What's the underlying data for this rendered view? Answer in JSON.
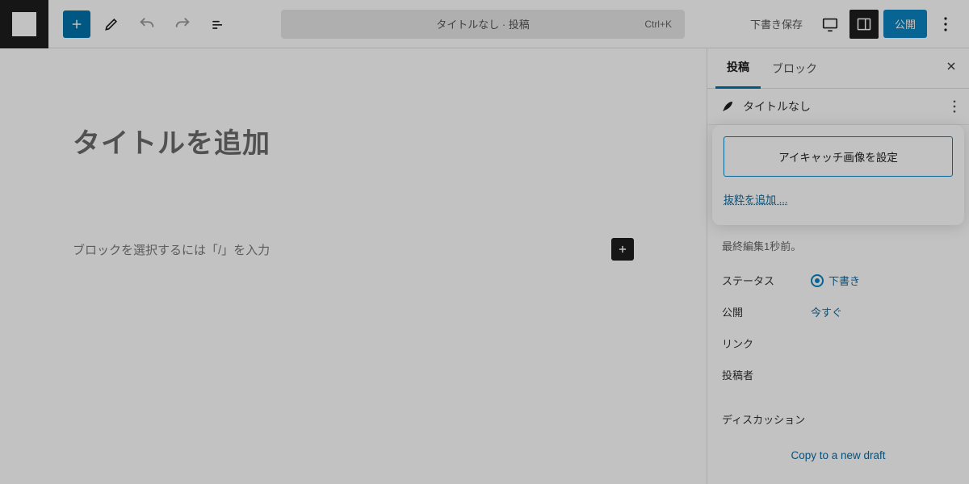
{
  "topbar": {
    "doc_title": "タイトルなし · 投稿",
    "shortcut": "Ctrl+K",
    "save_draft": "下書き保存",
    "publish": "公開"
  },
  "editor": {
    "title_placeholder": "タイトルを追加",
    "block_placeholder": "ブロックを選択するには「/」を入力"
  },
  "sidebar": {
    "tabs": {
      "post": "投稿",
      "block": "ブロック"
    },
    "summary_title": "タイトルなし",
    "featured_image_button": "アイキャッチ画像を設定",
    "excerpt_link": "抜粋を追加 ...",
    "last_edited": "最終編集1秒前。",
    "rows": {
      "status_label": "ステータス",
      "status_value": "下書き",
      "publish_label": "公開",
      "publish_value": "今すぐ",
      "link_label": "リンク",
      "author_label": "投稿者",
      "discussion_label": "ディスカッション"
    },
    "copy_draft": "Copy to a new draft"
  },
  "colors": {
    "accent": "#0a84c2"
  }
}
